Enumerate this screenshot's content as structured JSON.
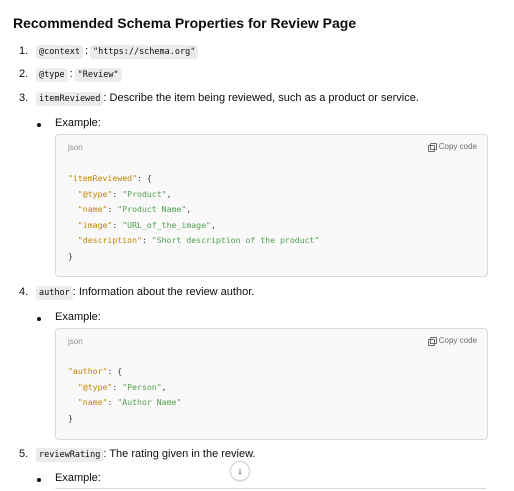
{
  "heading": "Recommended Schema Properties for Review Page",
  "items": [
    {
      "number": "1.",
      "code": "@context",
      "separator": ":",
      "value": "\"https://schema.org\""
    },
    {
      "number": "2.",
      "code": "@type",
      "separator": ":",
      "value": "\"Review\""
    },
    {
      "number": "3.",
      "code": "itemReviewed",
      "text": ": Describe the item being reviewed, such as a product or service."
    },
    {
      "number": "4.",
      "code": "author",
      "text": ": Information about the review author."
    },
    {
      "number": "5.",
      "code": "reviewRating",
      "text": ": The rating given in the review."
    }
  ],
  "example_label": "Example:",
  "code_blocks": [
    {
      "lang": "json",
      "copy_label": "Copy code",
      "lines": [
        [
          {
            "t": "\"itemReviewed\"",
            "c": "k"
          },
          {
            "t": ": {",
            "c": "p"
          }
        ],
        [
          {
            "t": "  ",
            "c": "p"
          },
          {
            "t": "\"@type\"",
            "c": "k"
          },
          {
            "t": ": ",
            "c": "p"
          },
          {
            "t": "\"Product\"",
            "c": "s"
          },
          {
            "t": ",",
            "c": "p"
          }
        ],
        [
          {
            "t": "  ",
            "c": "p"
          },
          {
            "t": "\"name\"",
            "c": "k"
          },
          {
            "t": ": ",
            "c": "p"
          },
          {
            "t": "\"Product Name\"",
            "c": "s"
          },
          {
            "t": ",",
            "c": "p"
          }
        ],
        [
          {
            "t": "  ",
            "c": "p"
          },
          {
            "t": "\"image\"",
            "c": "k"
          },
          {
            "t": ": ",
            "c": "p"
          },
          {
            "t": "\"URL_of_the_image\"",
            "c": "s"
          },
          {
            "t": ",",
            "c": "p"
          }
        ],
        [
          {
            "t": "  ",
            "c": "p"
          },
          {
            "t": "\"description\"",
            "c": "k"
          },
          {
            "t": ": ",
            "c": "p"
          },
          {
            "t": "\"Short description of the product\"",
            "c": "s"
          }
        ],
        [
          {
            "t": "}",
            "c": "p"
          }
        ]
      ]
    },
    {
      "lang": "json",
      "copy_label": "Copy code",
      "lines": [
        [
          {
            "t": "\"author\"",
            "c": "k"
          },
          {
            "t": ": {",
            "c": "p"
          }
        ],
        [
          {
            "t": "  ",
            "c": "p"
          },
          {
            "t": "\"@type\"",
            "c": "k"
          },
          {
            "t": ": ",
            "c": "p"
          },
          {
            "t": "\"Person\"",
            "c": "s"
          },
          {
            "t": ",",
            "c": "p"
          }
        ],
        [
          {
            "t": "  ",
            "c": "p"
          },
          {
            "t": "\"name\"",
            "c": "k"
          },
          {
            "t": ": ",
            "c": "p"
          },
          {
            "t": "\"Author Name\"",
            "c": "s"
          }
        ],
        [
          {
            "t": "}",
            "c": "p"
          }
        ]
      ]
    }
  ],
  "scroll_button_icon": "arrow-down-icon",
  "scroll_button_glyph": "↓"
}
